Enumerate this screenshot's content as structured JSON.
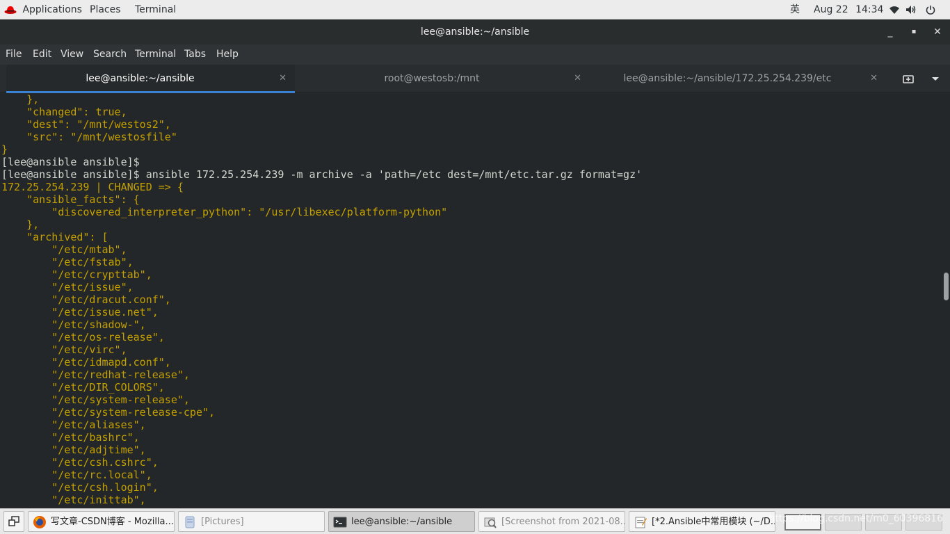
{
  "top_panel": {
    "applications": "Applications",
    "places": "Places",
    "terminal": "Terminal",
    "input_method": "英",
    "date": "Aug 22",
    "time": "14:34"
  },
  "window": {
    "title": "lee@ansible:~/ansible",
    "minimize": "_",
    "maximize": "▪",
    "close": "✕"
  },
  "menu": [
    "File",
    "Edit",
    "View",
    "Search",
    "Terminal",
    "Tabs",
    "Help"
  ],
  "tabs": [
    {
      "label": "lee@ansible:~/ansible",
      "active": true
    },
    {
      "label": "root@westosb:/mnt",
      "active": false
    },
    {
      "label": "lee@ansible:~/ansible/172.25.254.239/etc",
      "active": false
    }
  ],
  "terminal_lines": [
    {
      "text": "    },",
      "color": "yellow"
    },
    {
      "text": "    \"changed\": true,",
      "color": "yellow"
    },
    {
      "text": "    \"dest\": \"/mnt/westos2\",",
      "color": "yellow"
    },
    {
      "text": "    \"src\": \"/mnt/westosfile\"",
      "color": "yellow"
    },
    {
      "text": "}",
      "color": "yellow"
    },
    {
      "text": "[lee@ansible ansible]$",
      "color": "white"
    },
    {
      "text": "[lee@ansible ansible]$ ansible 172.25.254.239 -m archive -a 'path=/etc dest=/mnt/etc.tar.gz format=gz'",
      "color": "white"
    },
    {
      "text": "172.25.254.239 | CHANGED => {",
      "color": "yellow"
    },
    {
      "text": "    \"ansible_facts\": {",
      "color": "yellow"
    },
    {
      "text": "        \"discovered_interpreter_python\": \"/usr/libexec/platform-python\"",
      "color": "yellow"
    },
    {
      "text": "    },",
      "color": "yellow"
    },
    {
      "text": "    \"archived\": [",
      "color": "yellow"
    },
    {
      "text": "        \"/etc/mtab\",",
      "color": "yellow"
    },
    {
      "text": "        \"/etc/fstab\",",
      "color": "yellow"
    },
    {
      "text": "        \"/etc/crypttab\",",
      "color": "yellow"
    },
    {
      "text": "        \"/etc/issue\",",
      "color": "yellow"
    },
    {
      "text": "        \"/etc/dracut.conf\",",
      "color": "yellow"
    },
    {
      "text": "        \"/etc/issue.net\",",
      "color": "yellow"
    },
    {
      "text": "        \"/etc/shadow-\",",
      "color": "yellow"
    },
    {
      "text": "        \"/etc/os-release\",",
      "color": "yellow"
    },
    {
      "text": "        \"/etc/virc\",",
      "color": "yellow"
    },
    {
      "text": "        \"/etc/idmapd.conf\",",
      "color": "yellow"
    },
    {
      "text": "        \"/etc/redhat-release\",",
      "color": "yellow"
    },
    {
      "text": "        \"/etc/DIR_COLORS\",",
      "color": "yellow"
    },
    {
      "text": "        \"/etc/system-release\",",
      "color": "yellow"
    },
    {
      "text": "        \"/etc/system-release-cpe\",",
      "color": "yellow"
    },
    {
      "text": "        \"/etc/aliases\",",
      "color": "yellow"
    },
    {
      "text": "        \"/etc/bashrc\",",
      "color": "yellow"
    },
    {
      "text": "        \"/etc/adjtime\",",
      "color": "yellow"
    },
    {
      "text": "        \"/etc/csh.cshrc\",",
      "color": "yellow"
    },
    {
      "text": "        \"/etc/rc.local\",",
      "color": "yellow"
    },
    {
      "text": "        \"/etc/csh.login\",",
      "color": "yellow"
    },
    {
      "text": "        \"/etc/inittab\",",
      "color": "yellow"
    }
  ],
  "taskbar": {
    "items": [
      {
        "label": "写文章-CSDN博客 - Mozilla...",
        "icon": "firefox-icon",
        "active": false,
        "dim": false
      },
      {
        "label": "[Pictures]",
        "icon": "file-manager-icon",
        "active": false,
        "dim": true
      },
      {
        "label": "lee@ansible:~/ansible",
        "icon": "terminal-icon",
        "active": true,
        "dim": false
      },
      {
        "label": "[Screenshot from 2021-08...",
        "icon": "image-viewer-icon",
        "active": false,
        "dim": true
      },
      {
        "label": "[*2.Ansible中常用模块 (~/D...",
        "icon": "text-editor-icon",
        "active": false,
        "dim": false
      }
    ],
    "watermark": "https://blog.csdn.net/m0_60396816"
  },
  "colors": {
    "terminal_bg": "#232729",
    "yellow_text": "#c4a000",
    "white_text": "#d3d7cf",
    "tab_accent": "#3a82d1"
  }
}
